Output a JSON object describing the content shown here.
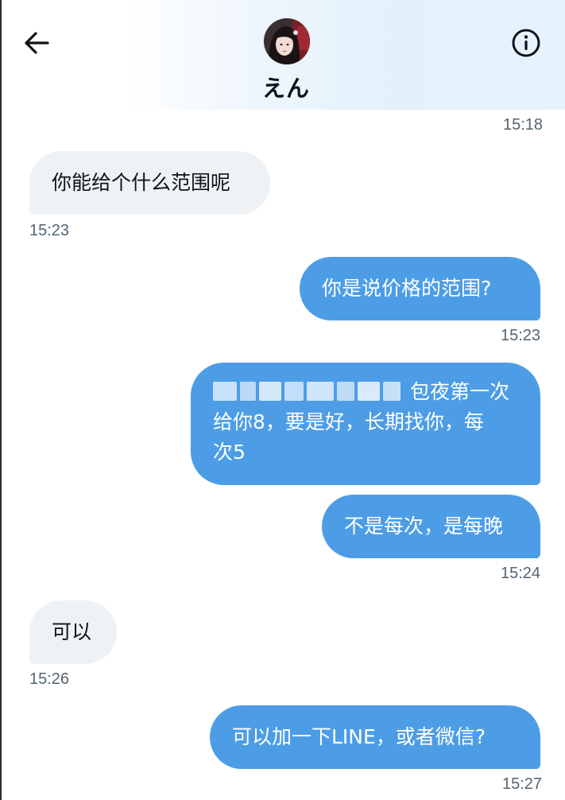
{
  "header": {
    "contact_name": "えん",
    "back_icon": "arrow-left-icon",
    "info_icon": "info-circle-icon"
  },
  "colors": {
    "outgoing_bubble": "#4d9de6",
    "incoming_bubble": "#eff2f4",
    "timestamp_text": "#536471"
  },
  "messages": [
    {
      "direction": "timestamp-only",
      "time": "15:18"
    },
    {
      "direction": "incoming",
      "text": "你能给个什么范围呢",
      "time": "15:23"
    },
    {
      "direction": "outgoing",
      "text": "你是说价格的范围?",
      "time": "15:23"
    },
    {
      "direction": "outgoing",
      "text_line1_tail": "包夜第一次",
      "text_line2": "给你8，要是好，长期找你，每",
      "text_line3": "次5",
      "redacted": true
    },
    {
      "direction": "outgoing",
      "text": "不是每次，是每晚",
      "time": "15:24"
    },
    {
      "direction": "incoming",
      "text": "可以",
      "time": "15:26"
    },
    {
      "direction": "outgoing",
      "text": "可以加一下LINE，或者微信?",
      "time": "15:27"
    }
  ]
}
